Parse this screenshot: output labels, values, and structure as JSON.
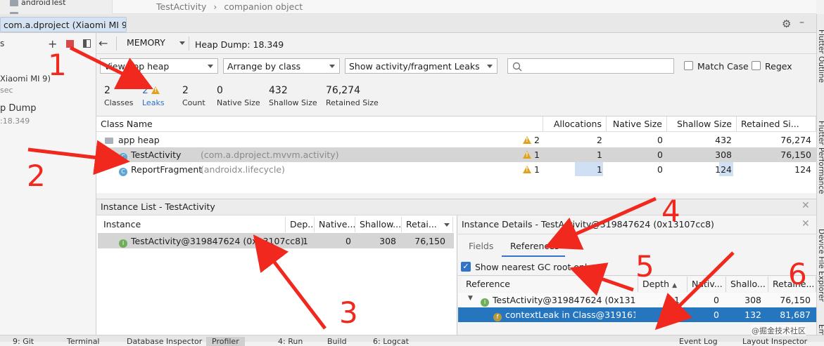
{
  "tree": {
    "item1": "androidTest"
  },
  "breadcrumb": {
    "part1": "TestActivity",
    "sep": "›",
    "part2": "companion object"
  },
  "device_tab": "com.a.dproject (Xiaomi MI 9)",
  "left_panel": {
    "device": "Xiaomi MI 9)",
    "sec": "sec",
    "dump": "p Dump",
    "dump_val": ":18.349",
    "frag_s": "s"
  },
  "toolbar": {
    "memory": "MEMORY",
    "heap_dump": "Heap Dump: 18.349"
  },
  "filters": {
    "heap": "View app heap",
    "arrange": "Arrange by class",
    "leaks": "Show activity/fragment Leaks",
    "match_case": "Match Case",
    "regex": "Regex"
  },
  "stats": [
    {
      "value": "2",
      "label": "Classes"
    },
    {
      "value": "2",
      "label": "Leaks"
    },
    {
      "value": "2",
      "label": "Count"
    },
    {
      "value": "0",
      "label": "Native Size"
    },
    {
      "value": "432",
      "label": "Shallow Size"
    },
    {
      "value": "76,274",
      "label": "Retained Size"
    }
  ],
  "class_table": {
    "headers": [
      "Class Name",
      "Allocations",
      "Native Size",
      "Shallow Size",
      "Retained Si..."
    ],
    "rows": [
      {
        "name": "app heap",
        "pkg": "",
        "warn": "2",
        "alloc": "2",
        "native": "0",
        "shallow": "432",
        "retained": "76,274"
      },
      {
        "name": "TestActivity",
        "pkg": "(com.a.dproject.mvvm.activity)",
        "warn": "1",
        "alloc": "1",
        "native": "0",
        "shallow": "308",
        "retained": "76,150"
      },
      {
        "name": "ReportFragment",
        "pkg": "(androidx.lifecycle)",
        "warn": "1",
        "alloc": "1",
        "native": "0",
        "shallow": "124",
        "retained": "124"
      }
    ]
  },
  "instance_list": {
    "title": "Instance List - TestActivity",
    "headers": [
      "Instance",
      "Dep...",
      "Native...",
      "Shallow...",
      "Retai..."
    ],
    "row": {
      "name": "TestActivity@319847624 (0x13107cc8)",
      "depth": "1",
      "native": "0",
      "shallow": "308",
      "retained": "76,150"
    }
  },
  "details": {
    "title": "Instance Details - TestActivity@319847624 (0x13107cc8)",
    "tabs": [
      "Fields",
      "References"
    ],
    "gc_root": "Show nearest GC root only",
    "headers": [
      "Reference",
      "Depth",
      "Nativ...",
      "Shallo...",
      "Retaine..."
    ],
    "rows": [
      {
        "name": "TestActivity@319847624 (0x13107c",
        "depth": "1",
        "native": "0",
        "shallow": "308",
        "retained": "76,150"
      },
      {
        "name": "contextLeak in Class@31916174",
        "depth": "0",
        "native": "0",
        "shallow": "132",
        "retained": "81,687"
      }
    ]
  },
  "right_strip": [
    "Flutter Outline",
    "Flutter Performance",
    "Device File Explorer",
    "Em"
  ],
  "bottom_tabs": [
    "9: Git",
    "Terminal",
    "Database Inspector",
    "Profiler",
    "4: Run",
    "Build",
    "6: Logcat",
    "Event Log",
    "Layout Inspector"
  ],
  "annotations": [
    "1",
    "2",
    "3",
    "4",
    "5",
    "6"
  ],
  "watermark": "@掘金技术社区",
  "colors": {
    "annotation": "#f0281e",
    "selection": "#2675bf",
    "row_highlight": "#d5d5d5",
    "warning": "#e0a21a"
  }
}
